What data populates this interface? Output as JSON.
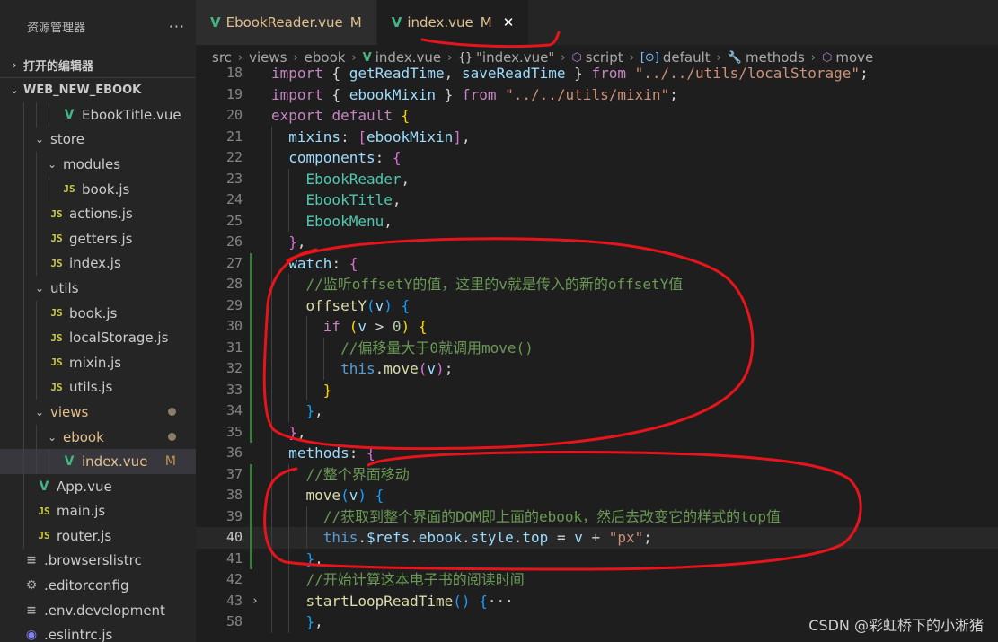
{
  "explorer": {
    "title": "资源管理器",
    "more_label": "···",
    "open_editors": "打开的编辑器",
    "project": "WEB_NEW_EBOOK"
  },
  "tree": [
    {
      "label": "EbookTitle.vue",
      "type": "vue",
      "depth": 3,
      "chev": ""
    },
    {
      "label": "store",
      "type": "folder",
      "depth": 1,
      "chev": "⌄"
    },
    {
      "label": "modules",
      "type": "folder",
      "depth": 2,
      "chev": "⌄"
    },
    {
      "label": "book.js",
      "type": "js",
      "depth": 3,
      "chev": ""
    },
    {
      "label": "actions.js",
      "type": "js",
      "depth": 2,
      "chev": ""
    },
    {
      "label": "getters.js",
      "type": "js",
      "depth": 2,
      "chev": ""
    },
    {
      "label": "index.js",
      "type": "js",
      "depth": 2,
      "chev": ""
    },
    {
      "label": "utils",
      "type": "folder",
      "depth": 1,
      "chev": "⌄"
    },
    {
      "label": "book.js",
      "type": "js",
      "depth": 2,
      "chev": ""
    },
    {
      "label": "localStorage.js",
      "type": "js",
      "depth": 2,
      "chev": ""
    },
    {
      "label": "mixin.js",
      "type": "js",
      "depth": 2,
      "chev": ""
    },
    {
      "label": "utils.js",
      "type": "js",
      "depth": 2,
      "chev": ""
    },
    {
      "label": "views",
      "type": "folder",
      "depth": 1,
      "chev": "⌄",
      "dot": true,
      "modified": true
    },
    {
      "label": "ebook",
      "type": "folder",
      "depth": 2,
      "chev": "⌄",
      "dot": true,
      "modified": true
    },
    {
      "label": "index.vue",
      "type": "vue",
      "depth": 3,
      "chev": "",
      "badge": "M",
      "modified": true,
      "selected": true
    },
    {
      "label": "App.vue",
      "type": "vue",
      "depth": 1,
      "chev": ""
    },
    {
      "label": "main.js",
      "type": "js",
      "depth": 1,
      "chev": ""
    },
    {
      "label": "router.js",
      "type": "js",
      "depth": 1,
      "chev": ""
    },
    {
      "label": ".browserslistrc",
      "type": "cfg",
      "depth": 0,
      "chev": "",
      "icon": "≡"
    },
    {
      "label": ".editorconfig",
      "type": "cfg",
      "depth": 0,
      "chev": "",
      "icon": "⚙"
    },
    {
      "label": ".env.development",
      "type": "cfg",
      "depth": 0,
      "chev": "",
      "icon": "≡"
    },
    {
      "label": ".eslintrc.js",
      "type": "eslint",
      "depth": 0,
      "chev": "",
      "icon": "◉"
    }
  ],
  "tabs": [
    {
      "name": "EbookReader.vue",
      "badge": "M",
      "active": false
    },
    {
      "name": "index.vue",
      "badge": "M",
      "active": true,
      "close": "✕"
    }
  ],
  "breadcrumb": [
    {
      "label": "src",
      "icon": ""
    },
    {
      "label": "views",
      "icon": ""
    },
    {
      "label": "ebook",
      "icon": ""
    },
    {
      "label": "index.vue",
      "icon": "V",
      "iconClass": "vue"
    },
    {
      "label": "\"index.vue\"",
      "icon": "{}",
      "iconClass": "braces"
    },
    {
      "label": "script",
      "icon": "⬡",
      "iconClass": "cube"
    },
    {
      "label": "default",
      "icon": "[⊙]",
      "iconClass": "def"
    },
    {
      "label": "methods",
      "icon": "🔧",
      "iconClass": "wrench"
    },
    {
      "label": "move",
      "icon": "⬡",
      "iconClass": "method"
    }
  ],
  "code": [
    {
      "n": "18",
      "tokens": [
        [
          "kw",
          "import"
        ],
        [
          "op",
          " { "
        ],
        [
          "var",
          "getReadTime"
        ],
        [
          "op",
          ", "
        ],
        [
          "var",
          "saveReadTime"
        ],
        [
          "op",
          " } "
        ],
        [
          "kw",
          "from"
        ],
        [
          "op",
          " "
        ],
        [
          "str",
          "\"../../utils/localStorage\""
        ],
        [
          "op",
          ";"
        ]
      ]
    },
    {
      "n": "19",
      "tokens": [
        [
          "kw",
          "import"
        ],
        [
          "op",
          " { "
        ],
        [
          "var",
          "ebookMixin"
        ],
        [
          "op",
          " } "
        ],
        [
          "kw",
          "from"
        ],
        [
          "op",
          " "
        ],
        [
          "str",
          "\"../../utils/mixin\""
        ],
        [
          "op",
          ";"
        ]
      ]
    },
    {
      "n": "20",
      "tokens": [
        [
          "kw",
          "export"
        ],
        [
          "op",
          " "
        ],
        [
          "kw",
          "default"
        ],
        [
          "op",
          " "
        ],
        [
          "p1",
          "{"
        ]
      ]
    },
    {
      "n": "21",
      "tokens": [
        [
          "op",
          "  "
        ],
        [
          "var",
          "mixins"
        ],
        [
          "op",
          ": "
        ],
        [
          "p2",
          "["
        ],
        [
          "var",
          "ebookMixin"
        ],
        [
          "p2",
          "]"
        ],
        [
          "op",
          ","
        ]
      ]
    },
    {
      "n": "22",
      "tokens": [
        [
          "op",
          "  "
        ],
        [
          "var",
          "components"
        ],
        [
          "op",
          ": "
        ],
        [
          "p2",
          "{"
        ]
      ]
    },
    {
      "n": "23",
      "tokens": [
        [
          "op",
          "    "
        ],
        [
          "cls",
          "EbookReader"
        ],
        [
          "op",
          ","
        ]
      ]
    },
    {
      "n": "24",
      "tokens": [
        [
          "op",
          "    "
        ],
        [
          "cls",
          "EbookTitle"
        ],
        [
          "op",
          ","
        ]
      ]
    },
    {
      "n": "25",
      "tokens": [
        [
          "op",
          "    "
        ],
        [
          "cls",
          "EbookMenu"
        ],
        [
          "op",
          ","
        ]
      ]
    },
    {
      "n": "26",
      "tokens": [
        [
          "op",
          "  "
        ],
        [
          "p2",
          "}"
        ],
        [
          "op",
          ","
        ]
      ]
    },
    {
      "n": "27",
      "tokens": [
        [
          "op",
          "  "
        ],
        [
          "var",
          "watch"
        ],
        [
          "op",
          ": "
        ],
        [
          "p2",
          "{"
        ]
      ],
      "mod": true
    },
    {
      "n": "28",
      "tokens": [
        [
          "op",
          "    "
        ],
        [
          "cm",
          "//监听offsetY的值，这里的v就是传入的新的offsetY值"
        ]
      ],
      "mod": true
    },
    {
      "n": "29",
      "tokens": [
        [
          "op",
          "    "
        ],
        [
          "fn",
          "offsetY"
        ],
        [
          "p3",
          "("
        ],
        [
          "var",
          "v"
        ],
        [
          "p3",
          ")"
        ],
        [
          "op",
          " "
        ],
        [
          "p3",
          "{"
        ]
      ],
      "mod": true
    },
    {
      "n": "30",
      "tokens": [
        [
          "op",
          "      "
        ],
        [
          "kw",
          "if"
        ],
        [
          "op",
          " "
        ],
        [
          "p1",
          "("
        ],
        [
          "var",
          "v"
        ],
        [
          "op",
          " > "
        ],
        [
          "num",
          "0"
        ],
        [
          "p1",
          ")"
        ],
        [
          "op",
          " "
        ],
        [
          "p1",
          "{"
        ]
      ],
      "mod": true
    },
    {
      "n": "31",
      "tokens": [
        [
          "op",
          "        "
        ],
        [
          "cm",
          "//偏移量大于0就调用move()"
        ]
      ],
      "mod": true
    },
    {
      "n": "32",
      "tokens": [
        [
          "op",
          "        "
        ],
        [
          "kw2",
          "this"
        ],
        [
          "op",
          "."
        ],
        [
          "fn",
          "move"
        ],
        [
          "p2",
          "("
        ],
        [
          "var",
          "v"
        ],
        [
          "p2",
          ")"
        ],
        [
          "op",
          ";"
        ]
      ],
      "mod": true
    },
    {
      "n": "33",
      "tokens": [
        [
          "op",
          "      "
        ],
        [
          "p1",
          "}"
        ]
      ],
      "mod": true
    },
    {
      "n": "34",
      "tokens": [
        [
          "op",
          "    "
        ],
        [
          "p3",
          "}"
        ],
        [
          "op",
          ","
        ]
      ],
      "mod": true
    },
    {
      "n": "35",
      "tokens": [
        [
          "op",
          "  "
        ],
        [
          "p2",
          "}"
        ],
        [
          "op",
          ","
        ]
      ],
      "mod": true
    },
    {
      "n": "36",
      "tokens": [
        [
          "op",
          "  "
        ],
        [
          "var",
          "methods"
        ],
        [
          "op",
          ": "
        ],
        [
          "p2",
          "{"
        ]
      ]
    },
    {
      "n": "37",
      "tokens": [
        [
          "op",
          "    "
        ],
        [
          "cm",
          "//整个界面移动"
        ]
      ],
      "mod": true
    },
    {
      "n": "38",
      "tokens": [
        [
          "op",
          "    "
        ],
        [
          "fn",
          "move"
        ],
        [
          "p3",
          "("
        ],
        [
          "var",
          "v"
        ],
        [
          "p3",
          ")"
        ],
        [
          "op",
          " "
        ],
        [
          "p3",
          "{"
        ]
      ],
      "mod": true
    },
    {
      "n": "39",
      "tokens": [
        [
          "op",
          "      "
        ],
        [
          "cm",
          "//获取到整个界面的DOM即上面的ebook，然后去改变它的样式的top值"
        ]
      ],
      "mod": true
    },
    {
      "n": "40",
      "tokens": [
        [
          "op",
          "      "
        ],
        [
          "kw2",
          "this"
        ],
        [
          "op",
          "."
        ],
        [
          "var",
          "$refs"
        ],
        [
          "op",
          "."
        ],
        [
          "var",
          "ebook"
        ],
        [
          "op",
          "."
        ],
        [
          "var",
          "style"
        ],
        [
          "op",
          "."
        ],
        [
          "var",
          "top"
        ],
        [
          "op",
          " = "
        ],
        [
          "var",
          "v"
        ],
        [
          "op",
          " + "
        ],
        [
          "str",
          "\"px\""
        ],
        [
          "op",
          ";"
        ]
      ],
      "mod": true,
      "current": true
    },
    {
      "n": "41",
      "tokens": [
        [
          "op",
          "    "
        ],
        [
          "p3",
          "}"
        ],
        [
          "op",
          ","
        ]
      ],
      "mod": true
    },
    {
      "n": "42",
      "tokens": [
        [
          "op",
          "    "
        ],
        [
          "cm",
          "//开始计算这本电子书的阅读时间"
        ]
      ]
    },
    {
      "n": "43",
      "tokens": [
        [
          "op",
          "    "
        ],
        [
          "fn",
          "startLoopReadTime"
        ],
        [
          "p3",
          "()"
        ],
        [
          "op",
          " "
        ],
        [
          "p3",
          "{"
        ],
        [
          "ell",
          "···"
        ]
      ],
      "fold": "›",
      "folded": true
    },
    {
      "n": "58",
      "tokens": [
        [
          "op",
          "    "
        ],
        [
          "p3",
          "}"
        ],
        [
          "op",
          ","
        ]
      ]
    }
  ],
  "watermark": "CSDN @彩虹桥下的小淅猪",
  "colors": {
    "annotation": "#e8141b",
    "vue": "#41b883",
    "modified": "#e2c08d"
  }
}
